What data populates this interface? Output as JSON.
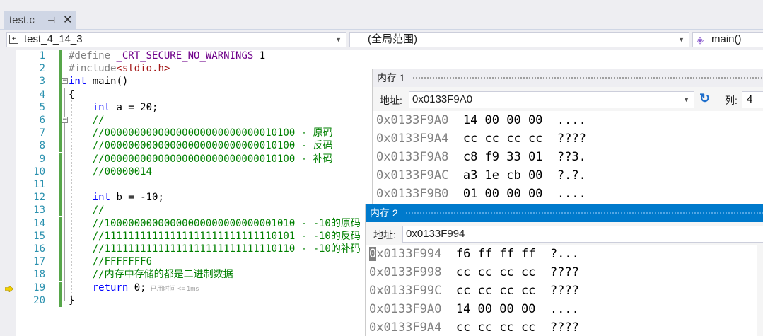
{
  "tab": {
    "filename": "test.c",
    "pin_glyph": "⊣",
    "close_glyph": "✕"
  },
  "navbar": {
    "project": "test_4_14_3",
    "scope": "(全局范围)",
    "function": "main()"
  },
  "code_lines": [
    {
      "n": "1",
      "parts": [
        [
          "pp",
          "#define "
        ],
        [
          "mac",
          "_CRT_SECURE_NO_WARNINGS"
        ],
        [
          "tx",
          " 1"
        ]
      ]
    },
    {
      "n": "2",
      "parts": [
        [
          "pp",
          "#include"
        ],
        [
          "str",
          "<stdio.h>"
        ]
      ]
    },
    {
      "n": "3",
      "parts": [
        [
          "kw",
          "int"
        ],
        [
          "tx",
          " main()"
        ]
      ]
    },
    {
      "n": "4",
      "parts": [
        [
          "tx",
          "{"
        ]
      ]
    },
    {
      "n": "5",
      "parts": [
        [
          "tx",
          "    "
        ],
        [
          "kw",
          "int"
        ],
        [
          "tx",
          " a = 20;"
        ]
      ]
    },
    {
      "n": "6",
      "parts": [
        [
          "cm",
          "    //"
        ]
      ]
    },
    {
      "n": "7",
      "parts": [
        [
          "cm",
          "    //00000000000000000000000000010100 - 原码"
        ]
      ]
    },
    {
      "n": "8",
      "parts": [
        [
          "cm",
          "    //00000000000000000000000000010100 - 反码"
        ]
      ]
    },
    {
      "n": "9",
      "parts": [
        [
          "cm",
          "    //00000000000000000000000000010100 - 补码"
        ]
      ]
    },
    {
      "n": "10",
      "parts": [
        [
          "cm",
          "    //00000014"
        ]
      ]
    },
    {
      "n": "11",
      "parts": []
    },
    {
      "n": "12",
      "parts": [
        [
          "tx",
          "    "
        ],
        [
          "kw",
          "int"
        ],
        [
          "tx",
          " b = -10;"
        ]
      ]
    },
    {
      "n": "13",
      "parts": [
        [
          "cm",
          "    //"
        ]
      ]
    },
    {
      "n": "14",
      "parts": [
        [
          "cm",
          "    //10000000000000000000000000001010 - -10的原码"
        ]
      ]
    },
    {
      "n": "15",
      "parts": [
        [
          "cm",
          "    //11111111111111111111111111110101 - -10的反码"
        ]
      ]
    },
    {
      "n": "16",
      "parts": [
        [
          "cm",
          "    //11111111111111111111111111110110 - -10的补码"
        ]
      ]
    },
    {
      "n": "17",
      "parts": [
        [
          "cm",
          "    //FFFFFFF6"
        ]
      ]
    },
    {
      "n": "18",
      "parts": [
        [
          "cm",
          "    //内存中存储的都是二进制数据"
        ]
      ]
    },
    {
      "n": "19",
      "parts": [
        [
          "tx",
          "    "
        ],
        [
          "kw",
          "return"
        ],
        [
          "tx",
          " 0;"
        ]
      ],
      "hint": "已用时间 <= 1ms"
    },
    {
      "n": "20",
      "parts": [
        [
          "tx",
          "}"
        ]
      ]
    }
  ],
  "memory1": {
    "title": "内存 1",
    "address_label": "地址:",
    "address_value": "0x0133F9A0",
    "columns_label": "列:",
    "columns_value": "4",
    "rows": [
      {
        "addr": "0x0133F9A0",
        "bytes": "14 00 00 00",
        "ascii": "...."
      },
      {
        "addr": "0x0133F9A4",
        "bytes": "cc cc cc cc",
        "ascii": "????"
      },
      {
        "addr": "0x0133F9A8",
        "bytes": "c8 f9 33 01",
        "ascii": "??3."
      },
      {
        "addr": "0x0133F9AC",
        "bytes": "a3 1e cb 00",
        "ascii": "?.?."
      },
      {
        "addr": "0x0133F9B0",
        "bytes": "01 00 00 00",
        "ascii": "...."
      }
    ]
  },
  "memory2": {
    "title": "内存 2",
    "address_label": "地址:",
    "address_value": "0x0133F994",
    "rows": [
      {
        "addr": "0x0133F994",
        "bytes": "f6 ff ff ff",
        "ascii": "?..."
      },
      {
        "addr": "0x0133F998",
        "bytes": "cc cc cc cc",
        "ascii": "????"
      },
      {
        "addr": "0x0133F99C",
        "bytes": "cc cc cc cc",
        "ascii": "????"
      },
      {
        "addr": "0x0133F9A0",
        "bytes": "14 00 00 00",
        "ascii": "...."
      },
      {
        "addr": "0x0133F9A4",
        "bytes": "cc cc cc cc",
        "ascii": "????"
      }
    ]
  },
  "colors": {
    "accent": "#007acc",
    "keyword": "#0000ff",
    "comment": "#008000",
    "line_number": "#2b91af",
    "change_bar": "#57a64a"
  }
}
